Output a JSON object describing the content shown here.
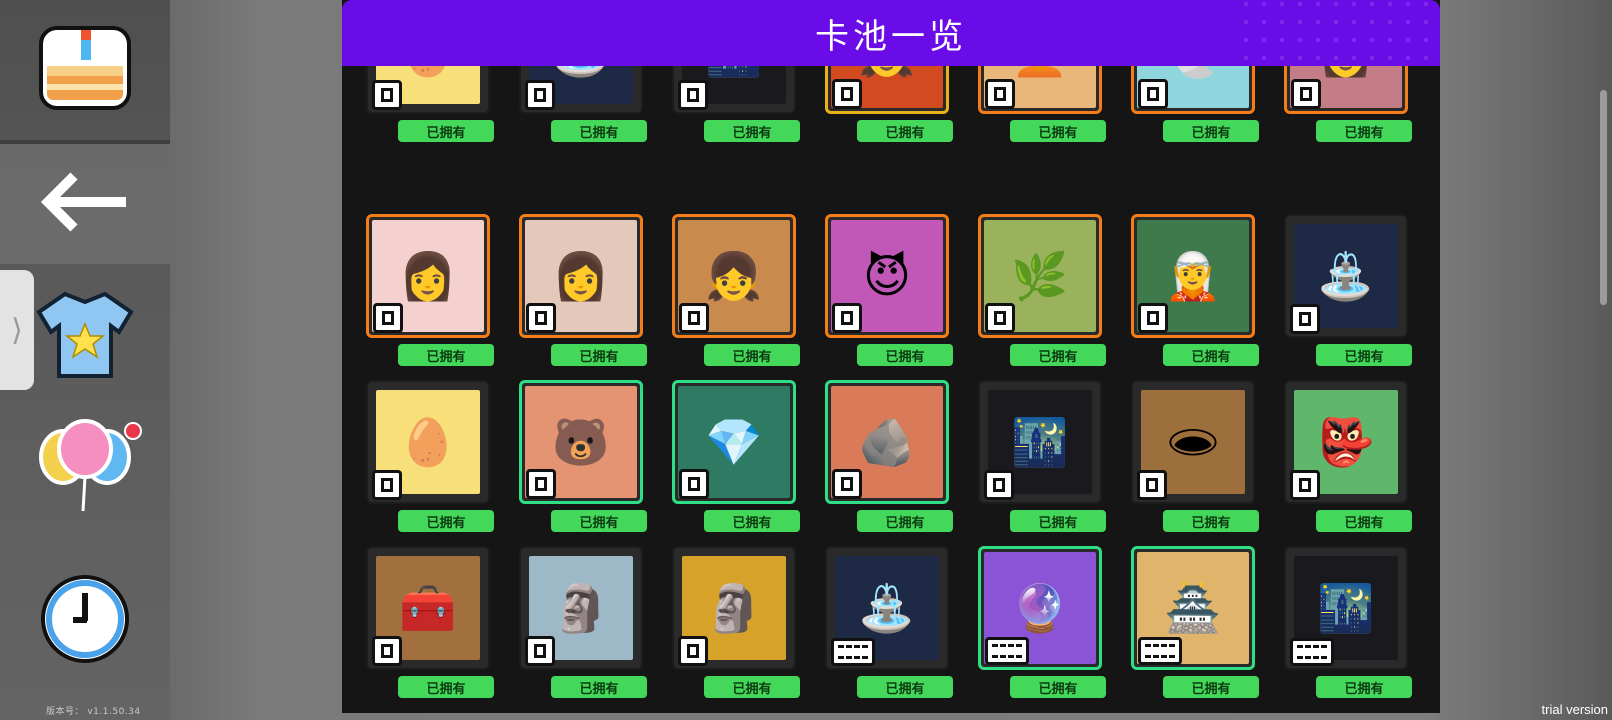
{
  "header": {
    "title": "卡池一览"
  },
  "sidebar": {
    "version": "版本号： v1.1.50.34",
    "handle_glyph": "⟩",
    "icons": [
      "cake-icon",
      "back-arrow-icon",
      "shirt-icon",
      "balloons-icon",
      "clock-icon"
    ]
  },
  "watermark": "trial version",
  "owned_label": "已拥有",
  "cards": [
    {
      "row": 0,
      "col": 0,
      "border": "none",
      "art": "duck-egg",
      "bg": "#f7df7a",
      "badge": "stack",
      "label": "已拥有"
    },
    {
      "row": 0,
      "col": 1,
      "border": "none",
      "art": "fountain",
      "bg": "#1e2a45",
      "badge": "stack",
      "label": "已拥有"
    },
    {
      "row": 0,
      "col": 2,
      "border": "none",
      "art": "night-city",
      "bg": "#1a1a1e",
      "badge": "stack",
      "label": "已拥有"
    },
    {
      "row": 0,
      "col": 3,
      "border": "gold",
      "art": "black-hair-girl",
      "bg": "#d24a1f",
      "badge": "square",
      "label": "已拥有"
    },
    {
      "row": 0,
      "col": 4,
      "border": "orange",
      "art": "blonde-girl",
      "bg": "#e9b77a",
      "badge": "square",
      "label": "已拥有"
    },
    {
      "row": 0,
      "col": 5,
      "border": "orange",
      "art": "ghost-witch",
      "bg": "#8fd5dd",
      "badge": "square",
      "label": "已拥有"
    },
    {
      "row": 0,
      "col": 6,
      "border": "orange",
      "art": "pink-hair-girl",
      "bg": "#c47d86",
      "badge": "square",
      "label": "已拥有"
    },
    {
      "row": 1,
      "col": 0,
      "border": "orange",
      "art": "white-hair-girl",
      "bg": "#f4d0cf",
      "badge": "square",
      "label": "已拥有"
    },
    {
      "row": 1,
      "col": 1,
      "border": "orange",
      "art": "brown-hair-girl",
      "bg": "#e4c8b9",
      "badge": "square",
      "label": "已拥有"
    },
    {
      "row": 1,
      "col": 2,
      "border": "orange",
      "art": "tan-girl",
      "bg": "#c98a4e",
      "badge": "square",
      "label": "已拥有"
    },
    {
      "row": 1,
      "col": 3,
      "border": "orange",
      "art": "demon-girl",
      "bg": "#c157b7",
      "badge": "square",
      "label": "已拥有"
    },
    {
      "row": 1,
      "col": 4,
      "border": "orange",
      "art": "dryad",
      "bg": "#9ab25c",
      "badge": "square",
      "label": "已拥有"
    },
    {
      "row": 1,
      "col": 5,
      "border": "orange",
      "art": "green-hat-girl",
      "bg": "#3f7a4c",
      "badge": "square",
      "label": "已拥有"
    },
    {
      "row": 1,
      "col": 6,
      "border": "none",
      "art": "fountain",
      "bg": "#1e2a45",
      "badge": "square",
      "label": "已拥有"
    },
    {
      "row": 2,
      "col": 0,
      "border": "none",
      "art": "duck-egg",
      "bg": "#f7df7a",
      "badge": "square",
      "label": "已拥有"
    },
    {
      "row": 2,
      "col": 1,
      "border": "green",
      "art": "bear",
      "bg": "#e59473",
      "badge": "square",
      "label": "已拥有"
    },
    {
      "row": 2,
      "col": 2,
      "border": "green",
      "art": "emerald",
      "bg": "#2f7a62",
      "badge": "square",
      "label": "已拥有"
    },
    {
      "row": 2,
      "col": 3,
      "border": "green",
      "art": "stone",
      "bg": "#d97a58",
      "badge": "square",
      "label": "已拥有"
    },
    {
      "row": 2,
      "col": 4,
      "border": "none",
      "art": "night-city",
      "bg": "#1a1a1e",
      "badge": "square",
      "label": "已拥有"
    },
    {
      "row": 2,
      "col": 5,
      "border": "none",
      "art": "pit",
      "bg": "#9d6f3d",
      "badge": "square",
      "label": "已拥有"
    },
    {
      "row": 2,
      "col": 6,
      "border": "none",
      "art": "goblin",
      "bg": "#5eb76a",
      "badge": "square",
      "label": "已拥有"
    },
    {
      "row": 3,
      "col": 0,
      "border": "none",
      "art": "chest",
      "bg": "#a1703e",
      "badge": "square",
      "label": "已拥有"
    },
    {
      "row": 3,
      "col": 1,
      "border": "none",
      "art": "gargoyle",
      "bg": "#9db9c7",
      "badge": "square",
      "label": "已拥有"
    },
    {
      "row": 3,
      "col": 2,
      "border": "none",
      "art": "golden-golem",
      "bg": "#d6a22a",
      "badge": "square",
      "label": "已拥有"
    },
    {
      "row": 3,
      "col": 3,
      "border": "none",
      "art": "fountain",
      "bg": "#1e2a45",
      "badge": "film",
      "label": "已拥有"
    },
    {
      "row": 3,
      "col": 4,
      "border": "green",
      "art": "crystal-cave",
      "bg": "#8b53d6",
      "badge": "film",
      "label": "已拥有"
    },
    {
      "row": 3,
      "col": 5,
      "border": "green",
      "art": "golden-palace",
      "bg": "#e0b46a",
      "badge": "film",
      "label": "已拥有"
    },
    {
      "row": 3,
      "col": 6,
      "border": "none",
      "art": "night-city",
      "bg": "#1a1a1e",
      "badge": "film",
      "label": "已拥有"
    }
  ]
}
